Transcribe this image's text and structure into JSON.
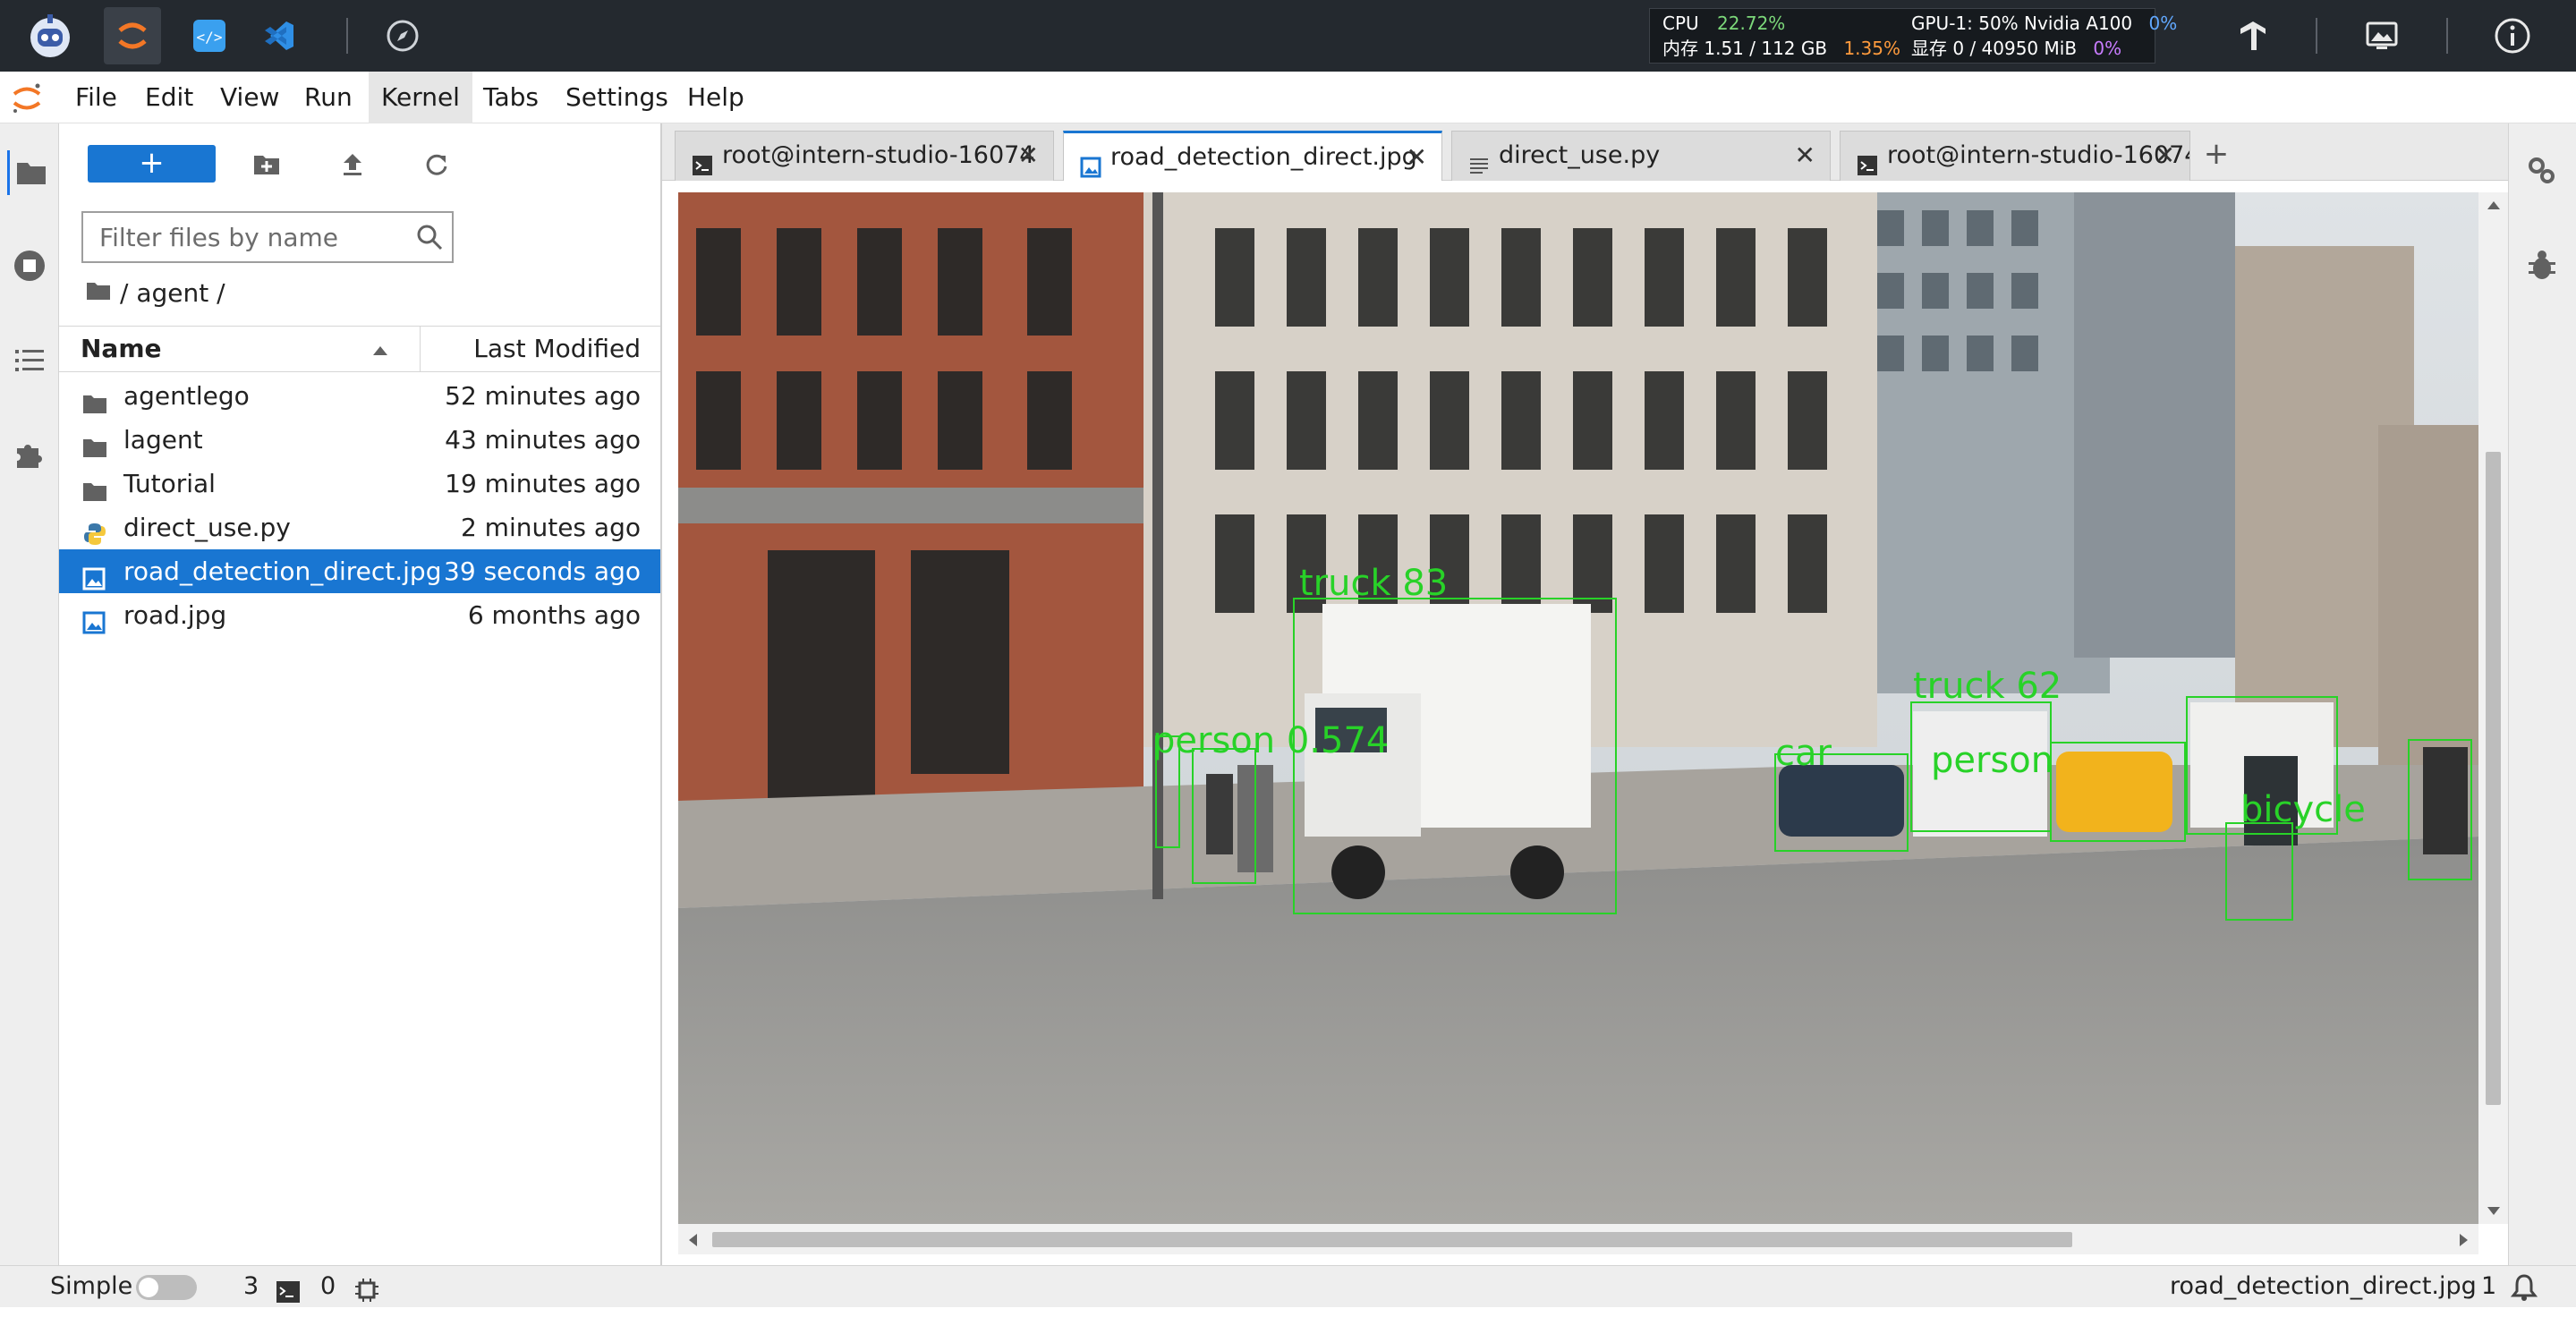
{
  "topbar": {
    "resources": {
      "cpu_label": "CPU",
      "cpu_value": "22.72%",
      "mem_label": "内存 1.51 / 112 GB",
      "mem_value": "1.35%",
      "gpu_label": "GPU-1: 50% Nvidia A100",
      "gpu_value": "0%",
      "vram_label": "显存 0 / 40950 MiB",
      "vram_value": "0%"
    }
  },
  "menubar": {
    "items": [
      "File",
      "Edit",
      "View",
      "Run",
      "Kernel",
      "Tabs",
      "Settings",
      "Help"
    ],
    "active": "Kernel"
  },
  "filebrowser": {
    "new_label": "+",
    "filter_placeholder": "Filter files by name",
    "breadcrumb": "/ agent /",
    "col_name": "Name",
    "col_modified": "Last Modified",
    "files": [
      {
        "name": "agentlego",
        "modified": "52 minutes ago",
        "type": "folder"
      },
      {
        "name": "lagent",
        "modified": "43 minutes ago",
        "type": "folder"
      },
      {
        "name": "Tutorial",
        "modified": "19 minutes ago",
        "type": "folder"
      },
      {
        "name": "direct_use.py",
        "modified": "2 minutes ago",
        "type": "python"
      },
      {
        "name": "road_detection_direct.jpg",
        "modified": "39 seconds ago",
        "type": "image",
        "selected": true
      },
      {
        "name": "road.jpg",
        "modified": "6 months ago",
        "type": "image"
      }
    ]
  },
  "tabs": [
    {
      "label": "root@intern-studio-16074",
      "type": "terminal"
    },
    {
      "label": "road_detection_direct.jpg",
      "type": "image",
      "active": true
    },
    {
      "label": "direct_use.py",
      "type": "text"
    },
    {
      "label": "root@intern-studio-16074",
      "type": "terminal"
    }
  ],
  "detections": {
    "truck_1": "truck 83",
    "person_1": "person 0.574",
    "truck_2": "truck 62",
    "car": "car",
    "person_2": "person",
    "bicycle": "bicycle"
  },
  "statusbar": {
    "mode": "Simple",
    "terminals": "3",
    "kernels": "0",
    "filename": "road_detection_direct.jpg",
    "line": "1"
  },
  "colors": {
    "accent": "#1976d2",
    "topbar": "#24292f",
    "detection_box": "#28d228"
  }
}
